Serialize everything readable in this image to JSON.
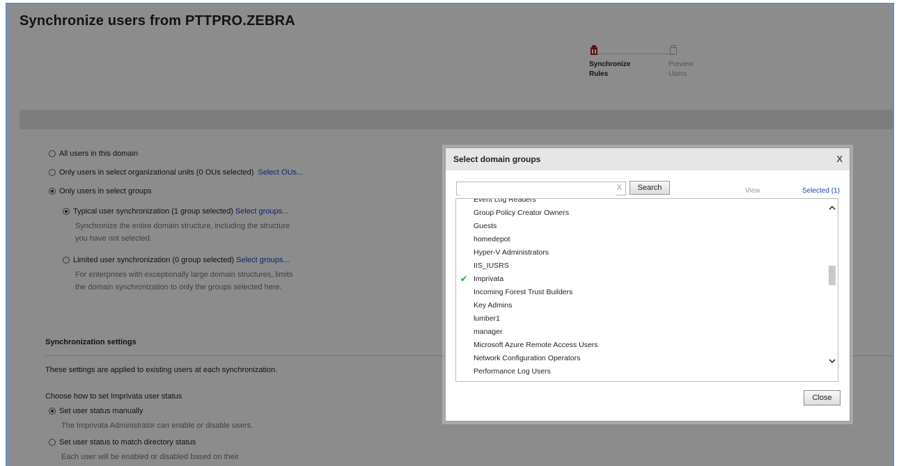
{
  "page": {
    "title": "Synchronize users from PTTPRO.ZEBRA"
  },
  "wizard": {
    "steps": [
      {
        "line1": "Synchronize",
        "line2": "Rules",
        "active": true
      },
      {
        "line1": "Preview",
        "line2": "Users",
        "active": false
      }
    ]
  },
  "scope": {
    "all_users": "All users in this domain",
    "select_ous": "Only users in select organizational units (0 OUs selected)",
    "select_ous_link": "Select OUs...",
    "select_groups": "Only users in select groups",
    "typical": "Typical user synchronization (1  group selected)",
    "typical_link": "Select groups...",
    "typical_desc_1": "Synchronize the entire domain structure, including the structure",
    "typical_desc_2": "you have not selected.",
    "limited": "Limited user synchronization (0  group selected)",
    "limited_link": "Select groups...",
    "limited_desc_1": "For enterprises with exceptionally large domain structures, limits",
    "limited_desc_2": "the domain synchronization to only the groups selected here."
  },
  "settings": {
    "title": "Synchronization settings",
    "note": "These settings are applied to existing users at each synchronization.",
    "choose": "Choose how to set Imprivata user status",
    "manual": "Set user status manually",
    "manual_desc": "The Imprivata Administrator can enable or disable users.",
    "match": "Set user status to match directory status",
    "match_desc": "Each user will be enabled or disabled based on their"
  },
  "dialog": {
    "title": "Select domain groups",
    "close_x": "X",
    "clear_x": "X",
    "search_value": "",
    "search_button": "Search",
    "tab_view": "View",
    "tab_selected": "Selected (1)",
    "close_button": "Close",
    "groups": [
      {
        "name": "Event Log Readers",
        "checked": false
      },
      {
        "name": "Group Policy Creator Owners",
        "checked": false
      },
      {
        "name": "Guests",
        "checked": false
      },
      {
        "name": "homedepot",
        "checked": false
      },
      {
        "name": "Hyper-V Administrators",
        "checked": false
      },
      {
        "name": "IIS_IUSRS",
        "checked": false
      },
      {
        "name": "Imprivata",
        "checked": true
      },
      {
        "name": "Incoming Forest Trust Builders",
        "checked": false
      },
      {
        "name": "Key Admins",
        "checked": false
      },
      {
        "name": "lumber1",
        "checked": false
      },
      {
        "name": "manager",
        "checked": false
      },
      {
        "name": "Microsoft Azure Remote Access Users",
        "checked": false
      },
      {
        "name": "Network Configuration Operators",
        "checked": false
      },
      {
        "name": "Performance Log Users",
        "checked": false
      }
    ]
  },
  "colors": {
    "accent_link": "#1a3fc6",
    "active_step": "#b02020",
    "check": "#3db33d",
    "frame_border": "#5b8fd0"
  }
}
